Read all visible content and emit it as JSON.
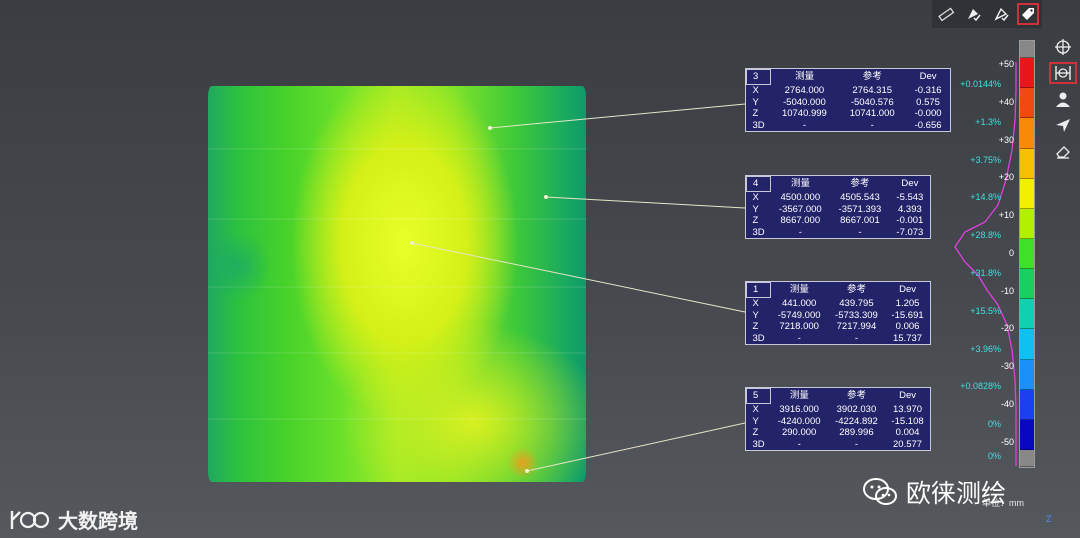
{
  "panels": [
    {
      "id": "3",
      "headers": [
        "测量",
        "参考",
        "Dev"
      ],
      "rows": [
        {
          "axis": "X",
          "meas": "2764.000",
          "ref": "2764.315",
          "dev": "-0.316"
        },
        {
          "axis": "Y",
          "meas": "-5040.000",
          "ref": "-5040.576",
          "dev": "0.575"
        },
        {
          "axis": "Z",
          "meas": "10740.999",
          "ref": "10741.000",
          "dev": "-0.000"
        },
        {
          "axis": "3D",
          "meas": "-",
          "ref": "-",
          "dev": "-0.656"
        }
      ]
    },
    {
      "id": "4",
      "headers": [
        "测量",
        "参考",
        "Dev"
      ],
      "rows": [
        {
          "axis": "X",
          "meas": "4500.000",
          "ref": "4505.543",
          "dev": "-5.543"
        },
        {
          "axis": "Y",
          "meas": "-3567.000",
          "ref": "-3571.393",
          "dev": "4.393"
        },
        {
          "axis": "Z",
          "meas": "8667.000",
          "ref": "8667.001",
          "dev": "-0.001"
        },
        {
          "axis": "3D",
          "meas": "-",
          "ref": "-",
          "dev": "-7.073"
        }
      ]
    },
    {
      "id": "1",
      "headers": [
        "测量",
        "参考",
        "Dev"
      ],
      "rows": [
        {
          "axis": "X",
          "meas": "441.000",
          "ref": "439.795",
          "dev": "1.205"
        },
        {
          "axis": "Y",
          "meas": "-5749.000",
          "ref": "-5733.309",
          "dev": "-15.691"
        },
        {
          "axis": "Z",
          "meas": "7218.000",
          "ref": "7217.994",
          "dev": "0.006"
        },
        {
          "axis": "3D",
          "meas": "-",
          "ref": "-",
          "dev": "15.737"
        }
      ]
    },
    {
      "id": "5",
      "headers": [
        "测量",
        "参考",
        "Dev"
      ],
      "rows": [
        {
          "axis": "X",
          "meas": "3916.000",
          "ref": "3902.030",
          "dev": "13.970"
        },
        {
          "axis": "Y",
          "meas": "-4240.000",
          "ref": "-4224.892",
          "dev": "-15.108"
        },
        {
          "axis": "Z",
          "meas": "290.000",
          "ref": "289.996",
          "dev": "0.004"
        },
        {
          "axis": "3D",
          "meas": "-",
          "ref": "-",
          "dev": "20.577"
        }
      ]
    }
  ],
  "scale": {
    "ticks": [
      "+50",
      "+40",
      "+30",
      "+20",
      "+10",
      "0",
      "-10",
      "-20",
      "-30",
      "-40",
      "-50"
    ],
    "percents": [
      "+0.0144%",
      "+1.3%",
      "+3.75%",
      "+14.8%",
      "+28.8%",
      "+31.8%",
      "+15.5%",
      "+3.96%",
      "+0.0828%",
      "0%",
      "0%"
    ],
    "colors": [
      "#888888",
      "#e81818",
      "#f04a10",
      "#f88a08",
      "#f8c000",
      "#f0f000",
      "#b0f000",
      "#3ee02a",
      "#18d060",
      "#10d0b0",
      "#10c0f0",
      "#1a90f8",
      "#1a40f0",
      "#0808c0",
      "#888888"
    ],
    "unit": "单位：mm",
    "axis_label": "Z"
  },
  "watermarks": {
    "left": "大数跨境",
    "right": "欧徕测绘"
  },
  "icons": {
    "top": [
      "ruler-icon",
      "pin-check-icon",
      "pin-check-alt-icon",
      "tag-icon"
    ],
    "right": [
      "crosshair-icon",
      "fit-view-icon",
      "person-view-icon",
      "navigate-icon",
      "eraser-icon"
    ]
  }
}
